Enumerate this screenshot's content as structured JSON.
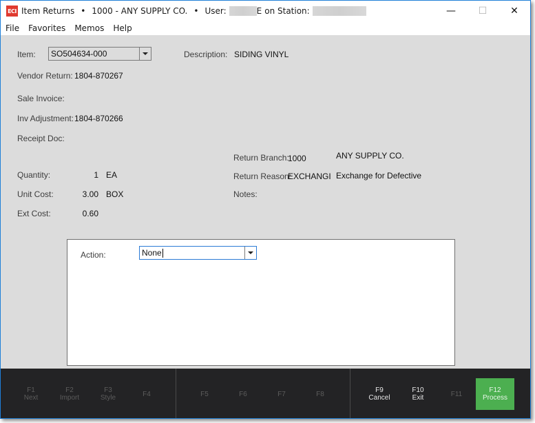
{
  "window": {
    "title": "Item Returns",
    "company": "1000 - ANY SUPPLY CO.",
    "user_label": "User:",
    "user_value_suffix": "E",
    "station_label": "on Station:",
    "separator": "•",
    "controls": {
      "minimize": "—",
      "maximize": "☐",
      "close": "✕"
    },
    "logo_text": "ECI"
  },
  "menu": [
    "File",
    "Favorites",
    "Memos",
    "Help"
  ],
  "form": {
    "item": {
      "label": "Item:",
      "value": "SO504634-000"
    },
    "description": {
      "label": "Description:",
      "value": "SIDING VINYL"
    },
    "vendor_return": {
      "label": "Vendor Return:",
      "value": "1804-870267"
    },
    "sale_invoice": {
      "label": "Sale Invoice:",
      "value": ""
    },
    "inv_adjustment": {
      "label": "Inv Adjustment:",
      "value": "1804-870266"
    },
    "receipt_doc": {
      "label": "Receipt Doc:",
      "value": ""
    },
    "return_branch": {
      "label": "Return Branch:",
      "code": "1000",
      "name": "ANY SUPPLY CO."
    },
    "return_reason": {
      "label": "Return Reason:",
      "code": "EXCHANGI",
      "description": "Exchange for Defective"
    },
    "notes": {
      "label": "Notes:",
      "value": ""
    },
    "quantity": {
      "label": "Quantity:",
      "value": "1",
      "unit": "EA"
    },
    "unit_cost": {
      "label": "Unit Cost:",
      "value": "3.00",
      "unit": "BOX"
    },
    "ext_cost": {
      "label": "Ext Cost:",
      "value": "0.60"
    }
  },
  "action": {
    "label": "Action:",
    "value": "None"
  },
  "function_keys": [
    {
      "key": "F1",
      "label": "Next",
      "enabled": false
    },
    {
      "key": "F2",
      "label": "Import",
      "enabled": false
    },
    {
      "key": "F3",
      "label": "Style",
      "enabled": false
    },
    {
      "key": "F4",
      "label": "",
      "enabled": false
    },
    {
      "key": "F5",
      "label": "",
      "enabled": false
    },
    {
      "key": "F6",
      "label": "",
      "enabled": false
    },
    {
      "key": "F7",
      "label": "",
      "enabled": false
    },
    {
      "key": "F8",
      "label": "",
      "enabled": false
    },
    {
      "key": "F9",
      "label": "Cancel",
      "enabled": true
    },
    {
      "key": "F10",
      "label": "Exit",
      "enabled": true
    },
    {
      "key": "F11",
      "label": "",
      "enabled": false
    },
    {
      "key": "F12",
      "label": "Process",
      "enabled": true,
      "primary": true
    }
  ],
  "colors": {
    "accent_border": "#1e7fd8",
    "logo": "#e03a2f",
    "process_button": "#4caf50",
    "function_bar": "#232325",
    "form_background": "#dcdcdc"
  }
}
